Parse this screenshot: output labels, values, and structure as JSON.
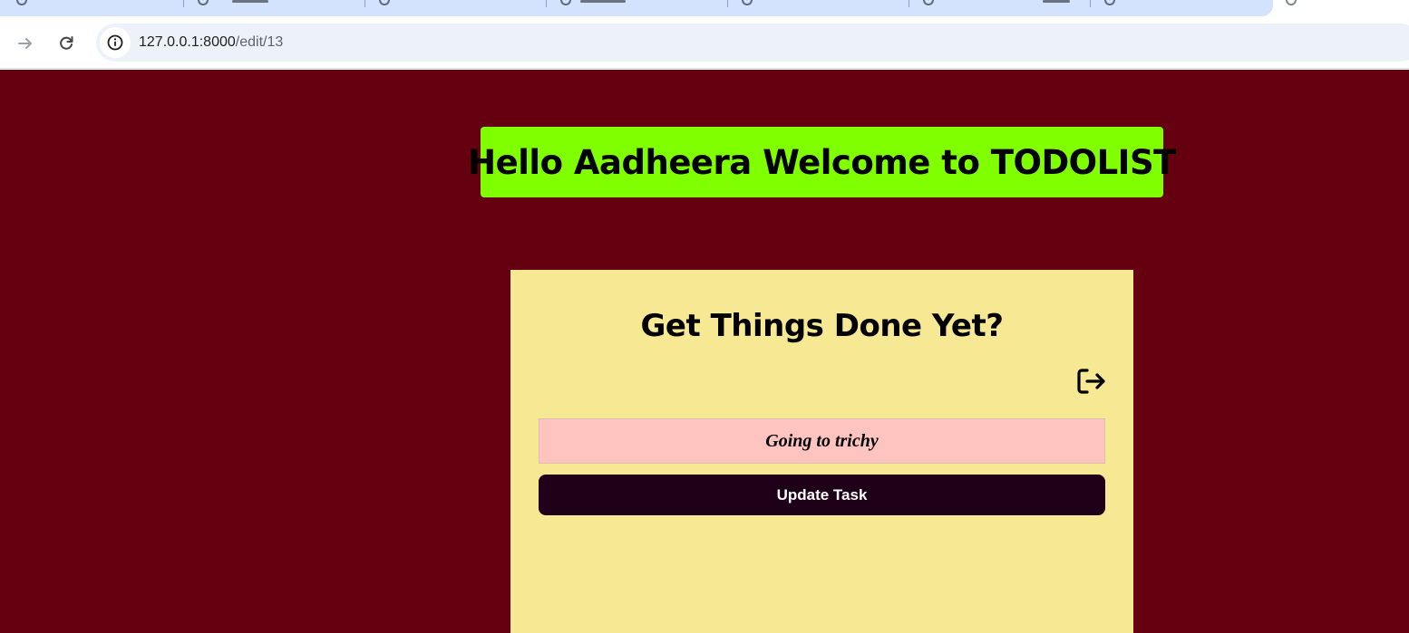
{
  "browser": {
    "url_host": "127.0.0.1:8000",
    "url_path": "/edit/13",
    "tab_bar_color": "#d3e3fd"
  },
  "page": {
    "background_color": "#650011",
    "welcome": {
      "text": "Hello Aadheera Welcome to TODOLIST",
      "background_color": "#7fff00"
    },
    "card": {
      "background_color": "#f7e894",
      "title": "Get Things Done Yet?",
      "logout_icon": "logout-icon",
      "task_input_value": "Going to trichy",
      "task_input_color": "#ffc3c0",
      "update_button_label": "Update Task",
      "update_button_color": "#1e0019"
    }
  }
}
